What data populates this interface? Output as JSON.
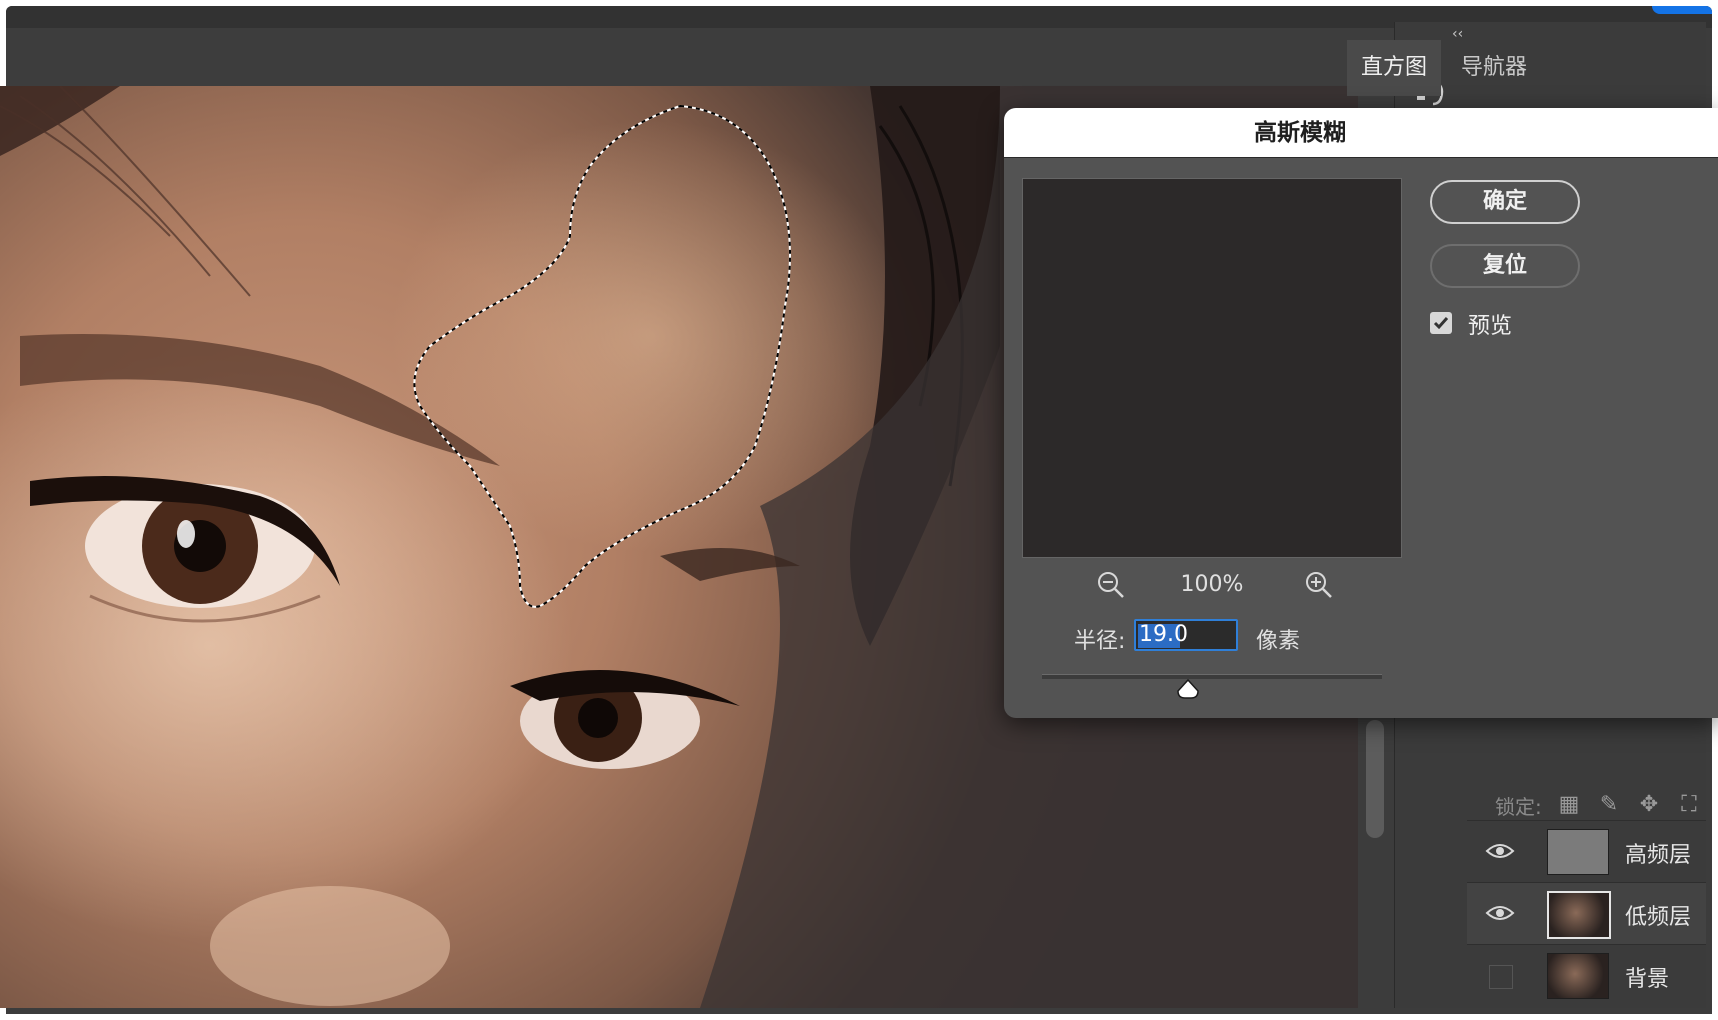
{
  "dock": {
    "collapse_arrows": "‹‹",
    "tabs": [
      "直方图",
      "导航器"
    ]
  },
  "dialog": {
    "title": "高斯模糊",
    "ok_label": "确定",
    "reset_label": "复位",
    "preview_label": "预览",
    "preview_checked": true,
    "zoom_percent": "100%",
    "radius_label": "半径:",
    "radius_value": "19.0",
    "unit_label": "像素",
    "slider_level": 0.43
  },
  "layers": {
    "lock_label": "锁定:",
    "items": [
      {
        "name": "高频层",
        "visible": true
      },
      {
        "name": "低频层",
        "visible": true,
        "selected": true
      },
      {
        "name": "背景",
        "visible": false
      }
    ]
  },
  "colors": {
    "accent": "#1473e6",
    "dialog_bg": "#535353",
    "panel_bg": "#3b3b3b"
  }
}
